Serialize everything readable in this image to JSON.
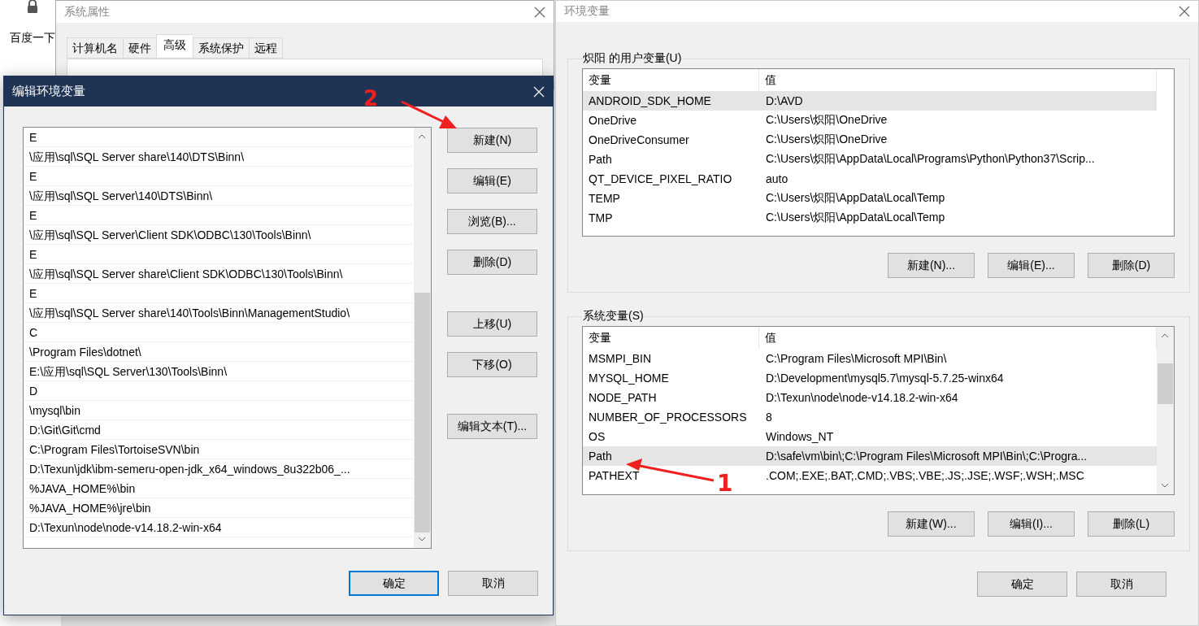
{
  "browser": {
    "search_button": "百度一下"
  },
  "system_properties": {
    "title": "系统属性",
    "tabs": [
      {
        "label": "计算机名",
        "selected": false
      },
      {
        "label": "硬件",
        "selected": false
      },
      {
        "label": "高级",
        "selected": true
      },
      {
        "label": "系统保护",
        "selected": false
      },
      {
        "label": "远程",
        "selected": false
      }
    ]
  },
  "edit_dialog": {
    "title": "编辑环境变量",
    "entries": [
      {
        "text": "E"
      },
      {
        "text": "\\应用\\sql\\SQL Server share\\140\\DTS\\Binn\\"
      },
      {
        "text": "E"
      },
      {
        "text": "\\应用\\sql\\SQL Server\\140\\DTS\\Binn\\"
      },
      {
        "text": "E"
      },
      {
        "text": "\\应用\\sql\\SQL Server\\Client SDK\\ODBC\\130\\Tools\\Binn\\"
      },
      {
        "text": "E"
      },
      {
        "text": "\\应用\\sql\\SQL Server share\\Client SDK\\ODBC\\130\\Tools\\Binn\\"
      },
      {
        "text": "E"
      },
      {
        "text": "\\应用\\sql\\SQL Server share\\140\\Tools\\Binn\\ManagementStudio\\"
      },
      {
        "text": "C"
      },
      {
        "text": "\\Program Files\\dotnet\\"
      },
      {
        "text": "E:\\应用\\sql\\SQL Server\\130\\Tools\\Binn\\"
      },
      {
        "text": "D"
      },
      {
        "text": "\\mysql\\bin"
      },
      {
        "text": "D:\\Git\\Git\\cmd"
      },
      {
        "text": "C:\\Program Files\\TortoiseSVN\\bin"
      },
      {
        "text": "D:\\Texun\\jdk\\ibm-semeru-open-jdk_x64_windows_8u322b06_..."
      },
      {
        "text": "%JAVA_HOME%\\bin"
      },
      {
        "text": "%JAVA_HOME%\\jre\\bin"
      },
      {
        "text": "D:\\Texun\\node\\node-v14.18.2-win-x64"
      }
    ],
    "side_button_groups": [
      [
        "新建(N)",
        "编辑(E)",
        "浏览(B)...",
        "删除(D)"
      ],
      [
        "上移(U)",
        "下移(O)"
      ],
      [
        "编辑文本(T)..."
      ]
    ],
    "footer_buttons": [
      {
        "label": "确定",
        "default": true
      },
      {
        "label": "取消",
        "default": false
      }
    ]
  },
  "env_window": {
    "title": "环境变量",
    "user_group": {
      "label": "炽阳 的用户变量(U)",
      "columns": [
        "变量",
        "值"
      ],
      "rows": [
        {
          "name": "ANDROID_SDK_HOME",
          "value": "D:\\AVD",
          "selected": true
        },
        {
          "name": "OneDrive",
          "value": "C:\\Users\\炽阳\\OneDrive",
          "selected": false
        },
        {
          "name": "OneDriveConsumer",
          "value": "C:\\Users\\炽阳\\OneDrive",
          "selected": false
        },
        {
          "name": "Path",
          "value": "C:\\Users\\炽阳\\AppData\\Local\\Programs\\Python\\Python37\\Scrip...",
          "selected": false
        },
        {
          "name": "QT_DEVICE_PIXEL_RATIO",
          "value": "auto",
          "selected": false
        },
        {
          "name": "TEMP",
          "value": "C:\\Users\\炽阳\\AppData\\Local\\Temp",
          "selected": false
        },
        {
          "name": "TMP",
          "value": "C:\\Users\\炽阳\\AppData\\Local\\Temp",
          "selected": false
        }
      ],
      "buttons": [
        "新建(N)...",
        "编辑(E)...",
        "删除(D)"
      ]
    },
    "system_group": {
      "label": "系统变量(S)",
      "columns": [
        "变量",
        "值"
      ],
      "rows": [
        {
          "name": "MSMPI_BIN",
          "value": "C:\\Program Files\\Microsoft MPI\\Bin\\",
          "selected": false
        },
        {
          "name": "MYSQL_HOME",
          "value": "D:\\Development\\mysql5.7\\mysql-5.7.25-winx64",
          "selected": false
        },
        {
          "name": "NODE_PATH",
          "value": "D:\\Texun\\node\\node-v14.18.2-win-x64",
          "selected": false
        },
        {
          "name": "NUMBER_OF_PROCESSORS",
          "value": "8",
          "selected": false
        },
        {
          "name": "OS",
          "value": "Windows_NT",
          "selected": false
        },
        {
          "name": "Path",
          "value": "D:\\safe\\vm\\bin\\;C:\\Program Files\\Microsoft MPI\\Bin\\;C:\\Progra...",
          "selected": true
        },
        {
          "name": "PATHEXT",
          "value": ".COM;.EXE;.BAT;.CMD;.VBS;.VBE;.JS;.JSE;.WSF;.WSH;.MSC",
          "selected": false
        }
      ],
      "buttons": [
        "新建(W)...",
        "编辑(I)...",
        "删除(L)"
      ]
    },
    "footer_buttons": [
      "确定",
      "取消"
    ]
  },
  "annotations": [
    {
      "label": "2"
    },
    {
      "label": "1"
    }
  ]
}
